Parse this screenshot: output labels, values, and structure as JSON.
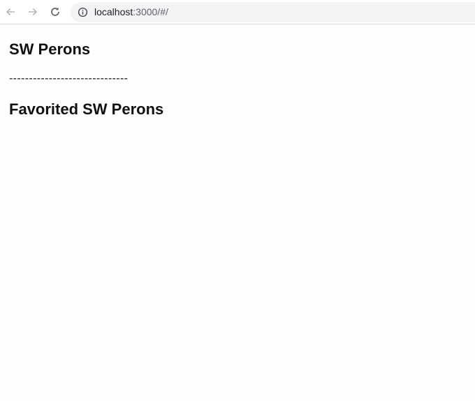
{
  "browser": {
    "url_host": "localhost",
    "url_rest": ":3000/#/"
  },
  "page": {
    "title": "SW Perons",
    "divider": "------------------------------",
    "favorites_title": "Favorited SW Perons"
  }
}
